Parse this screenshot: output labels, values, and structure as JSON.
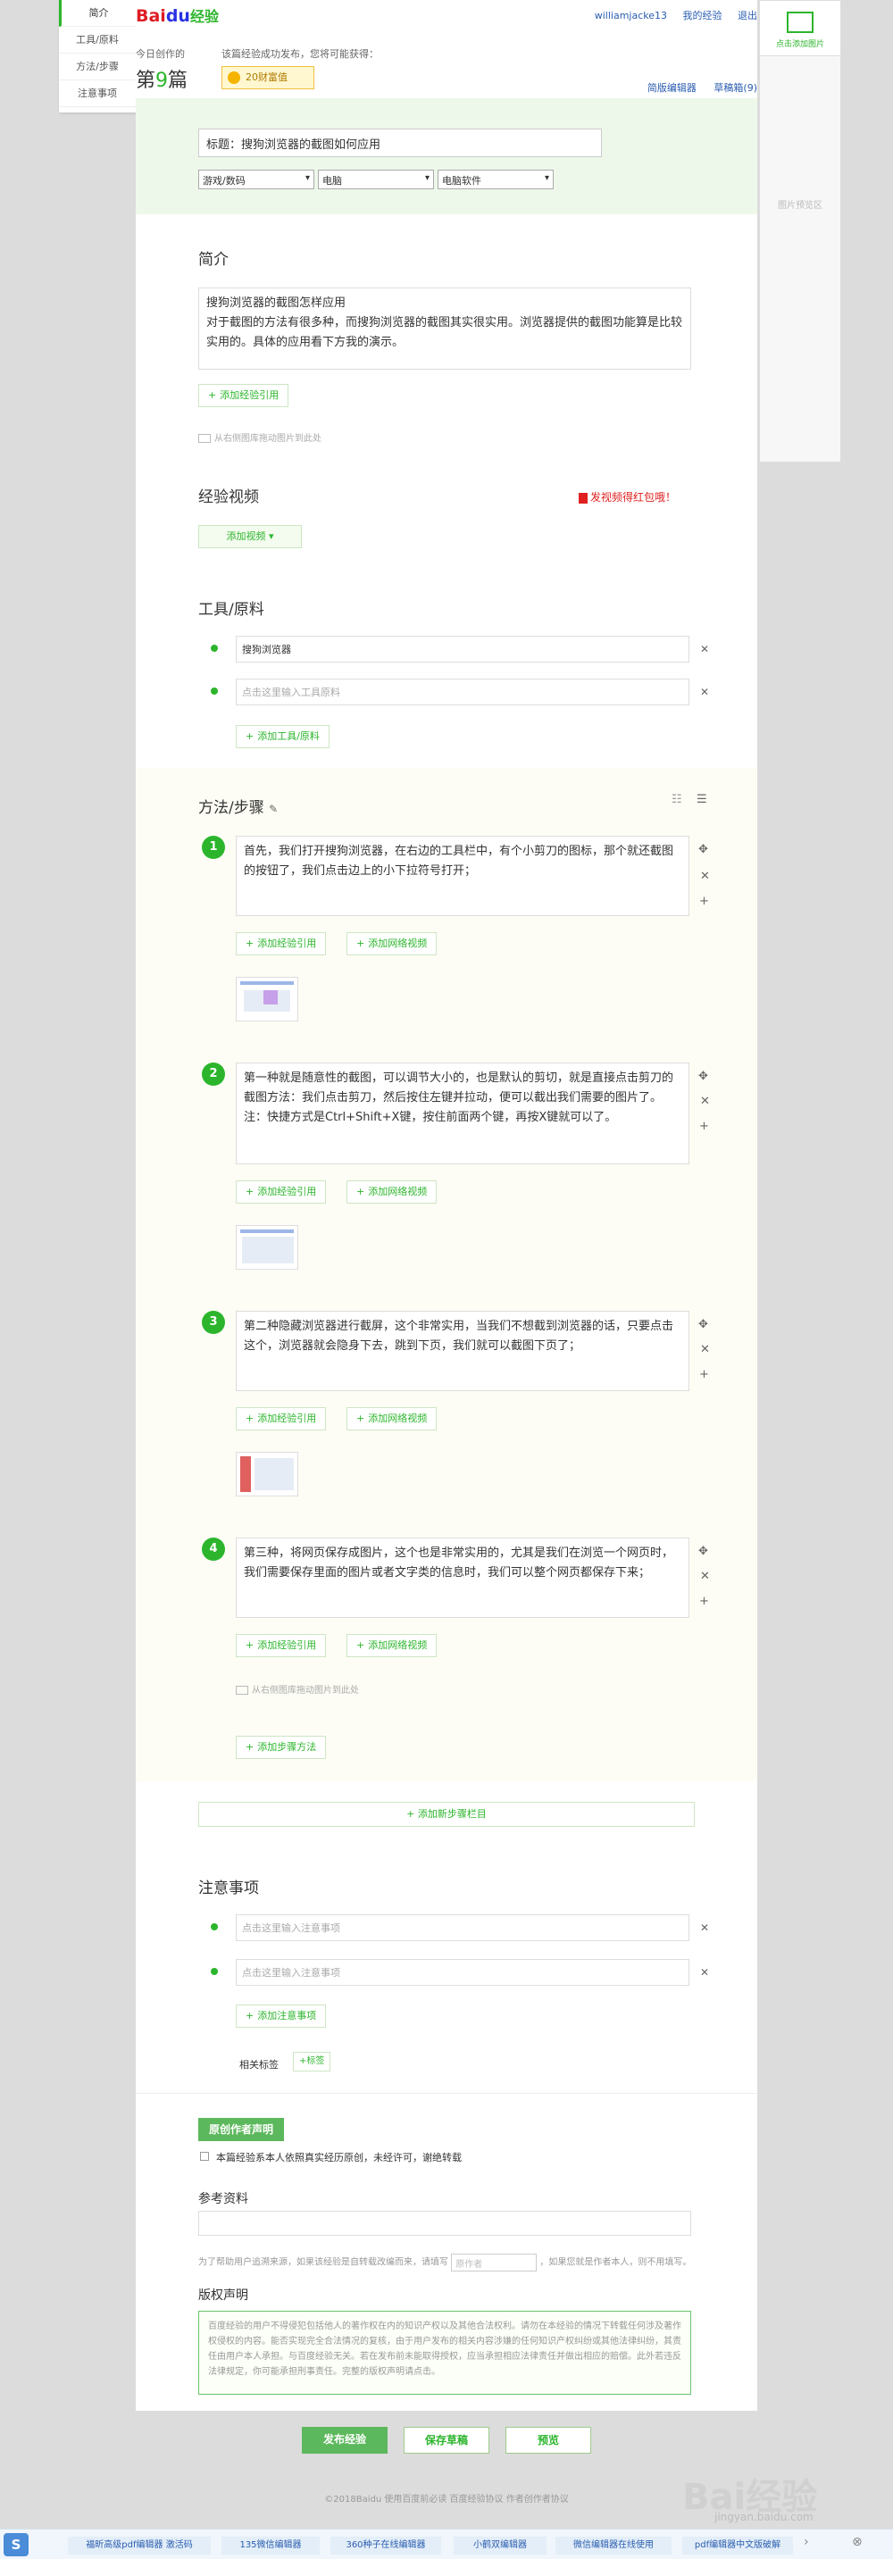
{
  "brand": {
    "logo_bai": "Bai",
    "logo_du": "du",
    "logo_jy": "经验"
  },
  "user_links": [
    "williamjacke13",
    "我的经验",
    "退出"
  ],
  "header": {
    "today_label": "今日创作的",
    "today_prefix": "第",
    "today_num": "9",
    "today_suffix": "篇",
    "reward_label": "该篇经验成功发布，您将可能获得：",
    "reward_badge": "20财富值",
    "editor_links": [
      "简版编辑器",
      "草稿箱(9)"
    ]
  },
  "left_nav": [
    "简介",
    "工具/原料",
    "方法/步骤",
    "注意事项"
  ],
  "right_panel": {
    "upload_label": "点击添加图片",
    "hint": "图片预览区"
  },
  "title_section": {
    "title_placeholder": "标题：搜狗浏览器的截图如何应用",
    "selects": [
      "游戏/数码",
      "电脑",
      "电脑软件"
    ]
  },
  "intro": {
    "heading": "简介",
    "lines": [
      "搜狗浏览器的截图怎样应用",
      "对于截图的方法有很多种，而搜狗浏览器的截图其实很实用。浏览器提供的截图功能算是比较实用的。具体的应用看下方我的演示。"
    ],
    "add_ref": "添加经验引用",
    "note": "从右侧图库拖动图片到此处"
  },
  "video": {
    "heading": "经验视频",
    "promo": "发视频得红包哦！",
    "add_btn": "添加视频"
  },
  "tools": {
    "heading": "工具/原料",
    "items": [
      "搜狗浏览器",
      "点击这里输入工具原料"
    ],
    "add_btn": "添加工具/原料"
  },
  "steps": {
    "heading": "方法/步骤",
    "items": [
      {
        "num": "1",
        "text": "首先，我们打开搜狗浏览器，在右边的工具栏中，有个小剪刀的图标，那个就还截图的按钮了，我们点击边上的小下拉符号打开；"
      },
      {
        "num": "2",
        "text": "第一种就是随意性的截图，可以调节大小的，也是默认的剪切，就是直接点击剪刀的截图方法：我们点击剪刀，然后按住左键并拉动，便可以截出我们需要的图片了。注：快捷方式是Ctrl+Shift+X键，按住前面两个键，再按X键就可以了。"
      },
      {
        "num": "3",
        "text": "第二种隐藏浏览器进行截屏，这个非常实用，当我们不想截到浏览器的话，只要点击这个，浏览器就会隐身下去，跳到下页，我们就可以截图下页了；"
      },
      {
        "num": "4",
        "text": "第三种，将网页保存成图片，这个也是非常实用的，尤其是我们在浏览一个网页时，我们需要保存里面的图片或者文字类的信息时，我们可以整个网页都保存下来；"
      }
    ],
    "add_ref": "添加经验引用",
    "add_video": "添加网络视频",
    "drag_note": "从右侧图库拖动图片到此处",
    "add_step": "添加步骤方法",
    "add_new_section": "添加新步骤栏目"
  },
  "notes": {
    "heading": "注意事项",
    "items": [
      "点击这里输入注意事项",
      "点击这里输入注意事项"
    ],
    "add_btn": "添加注意事项",
    "tags_label": "相关标签",
    "tags_add": "+标签"
  },
  "original": {
    "btn": "原创作者声明",
    "checkbox_label": "本篇经验系本人依照真实经历原创，未经许可，谢绝转载"
  },
  "reference": {
    "heading": "参考资料",
    "note_a": "为了帮助用户追溯来源，如果该经验是自转载改编而来，请填写",
    "note_placeholder": "原作者",
    "note_b": "，如果您就是作者本人，则不用填写。"
  },
  "copyright": {
    "heading": "版权声明",
    "text": "百度经验的用户不得侵犯包括他人的著作权在内的知识产权以及其他合法权利。请勿在本经验的情况下转载任何涉及著作权侵权的内容。能否实现完全合法情况的复核，由于用户发布的相关内容涉嫌的任何知识产权纠纷或其他法律纠纷，其责任由用户本人承担。与百度经验无关。若在发布前未能取得授权，应当承担相应法律责任并做出相应的赔偿。此外若违反法律规定，你可能承担刑事责任。完整的版权声明请点击。"
  },
  "bottom_buttons": [
    "发布经验",
    "保存草稿",
    "预览"
  ],
  "footer": "©2018Baidu  使用百度前必读  百度经验协议  作者创作者协议",
  "watermark": {
    "main": "Bai经验",
    "sub": "jingyan.baidu.com"
  },
  "bottom_bar": {
    "tags": [
      "福昕高级pdf编辑器 激活码",
      "135微信编辑器",
      "360种子在线编辑器",
      "小鹤双编辑器",
      "微信编辑器在线使用",
      "pdf编辑器中文版破解"
    ]
  }
}
